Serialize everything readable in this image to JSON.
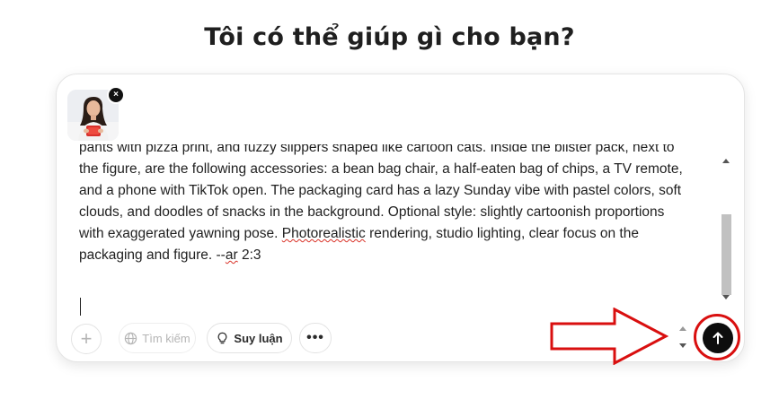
{
  "page": {
    "title": "Tôi có thể giúp gì cho bạn?"
  },
  "attachment": {
    "remove_glyph": "×"
  },
  "prompt": {
    "line_1": "pants with pizza print, and fuzzy slippers shaped like cartoon cats. Inside the blister pack, next to",
    "line_2": "the figure, are the following accessories: a bean bag chair, a half-eaten bag of chips, a TV remote,",
    "line_3": "and a phone with TikTok open. The packaging card has a lazy Sunday vibe with pastel colors, soft",
    "line_4": "clouds, and doodles of snacks in the background. Optional style: slightly cartoonish proportions",
    "line_5_pre": "with exaggerated yawning pose. ",
    "line_5_spell": "Photorealistic",
    "line_5_post": " rendering, studio lighting, clear focus on the",
    "line_6_pre": "packaging and figure. --",
    "line_6_spell": "ar",
    "line_6_post": " 2:3"
  },
  "toolbar": {
    "plus_glyph": "+",
    "search_label": "Tìm kiếm",
    "reason_label": "Suy luận",
    "more_glyph": "•••"
  },
  "icons": {
    "attach": "plus-icon",
    "search": "globe-icon",
    "reason": "lightbulb-icon",
    "more": "ellipsis-icon",
    "send": "arrow-up-icon",
    "remove": "close-icon"
  },
  "colors": {
    "send_button": "#0d0d0d",
    "annotation": "#d90f0f",
    "spellcheck": "#d93025"
  }
}
